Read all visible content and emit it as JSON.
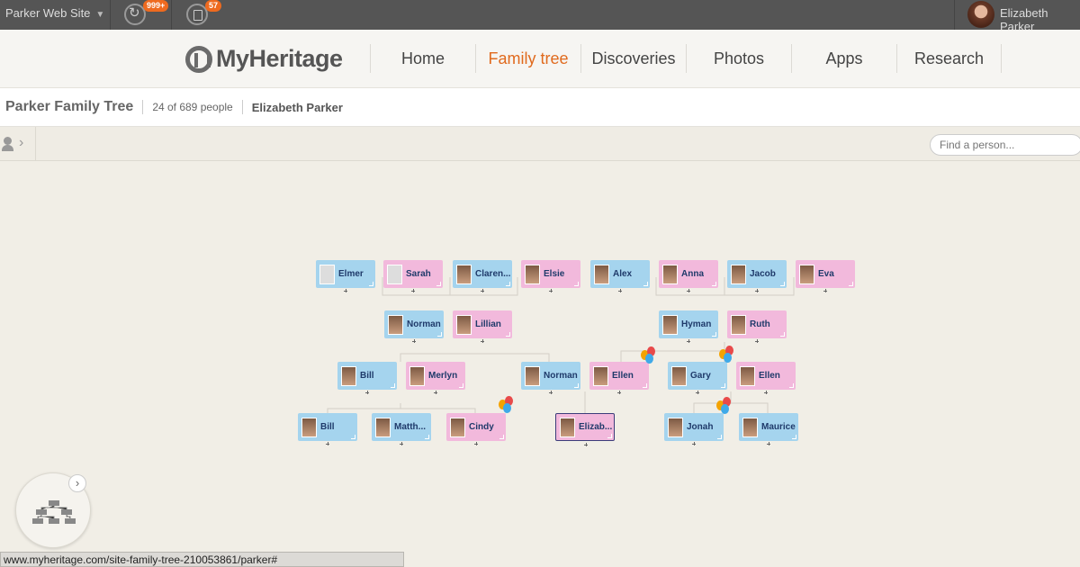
{
  "topbar": {
    "site_name": "Parker Web Site",
    "sync_badge": "999+",
    "news_badge": "57",
    "user_name": "Elizabeth Parker"
  },
  "brand": {
    "logo_text": "MyHeritage"
  },
  "nav": {
    "items": [
      "Home",
      "Family tree",
      "Discoveries",
      "Photos",
      "Apps",
      "Research"
    ],
    "active": "Family tree"
  },
  "tree": {
    "name": "Parker Family Tree",
    "count": "24 of 689 people",
    "current_person": "Elizabeth Parker"
  },
  "search": {
    "placeholder": "Find a person..."
  },
  "people": {
    "elmer": "Elmer",
    "sarah": "Sarah",
    "clarence": "Claren...",
    "elsie": "Elsie",
    "alex": "Alex",
    "anna": "Anna",
    "jacob": "Jacob",
    "eva": "Eva",
    "norman_sr": "Norman",
    "lillian": "Lillian",
    "hyman": "Hyman",
    "ruth": "Ruth",
    "bill_sr": "Bill",
    "merlyn": "Merlyn",
    "norman": "Norman",
    "ellen": "Ellen",
    "gary": "Gary",
    "ellen2": "Ellen",
    "bill": "Bill",
    "matthew": "Matth...",
    "cindy": "Cindy",
    "elizabeth": "Elizab...",
    "jonah": "Jonah",
    "maurice": "Maurice"
  },
  "status_url": "www.myheritage.com/site-family-tree-210053861/parker#",
  "colors": {
    "male": "#a5d4ee",
    "female": "#f2b9dc",
    "accent": "#e06a1e"
  }
}
